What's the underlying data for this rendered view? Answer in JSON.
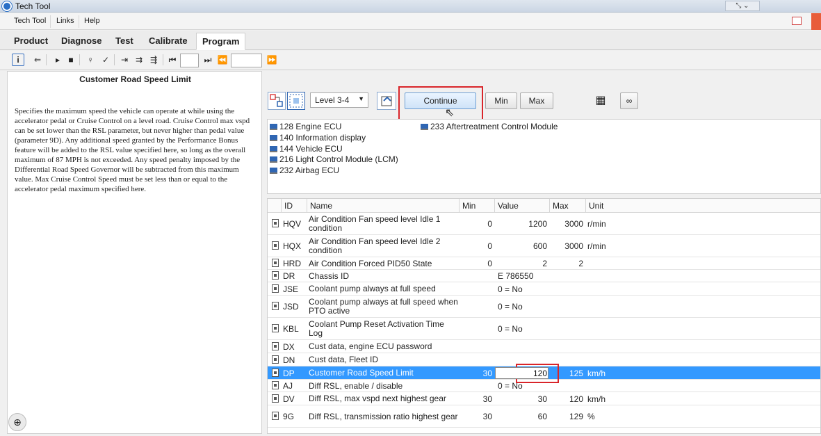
{
  "window": {
    "title": "Tech Tool"
  },
  "menu": {
    "items": [
      "Tech Tool",
      "Links",
      "Help"
    ]
  },
  "tabs": [
    {
      "label": "Product"
    },
    {
      "label": "Diagnose"
    },
    {
      "label": "Test"
    },
    {
      "label": "Calibrate"
    },
    {
      "label": "Program"
    }
  ],
  "left": {
    "title": "Customer Road Speed Limit",
    "description": "Specifies the maximum speed the vehicle can operate at while using the accelerator pedal or Cruise Control on a level road. Cruise Control max vspd can be set lower than the RSL parameter, but never higher than pedal value (parameter 9D). Any additional speed granted by the Performance Bonus feature will be added to the RSL value specified here, so long as the overall maximum of 87 MPH is not exceeded. Any speed penalty imposed by the Differential Road Speed Governor will be subtracted from this maximum value. Max Cruise Control Speed must be set less than or equal to the accelerator pedal maximum specified here."
  },
  "controls": {
    "level": "Level 3-4",
    "continue": "Continue",
    "min": "Min",
    "max": "Max"
  },
  "ecus": [
    {
      "label": "128  Engine ECU"
    },
    {
      "label": "140  Information display"
    },
    {
      "label": "144  Vehicle ECU"
    },
    {
      "label": "216  Light Control Module (LCM)"
    },
    {
      "label": "232  Airbag ECU"
    },
    {
      "label": "233  Aftertreatment Control Module"
    }
  ],
  "grid": {
    "headers": [
      "ID",
      "Name",
      "Min",
      "Value",
      "Max",
      "Unit"
    ],
    "rows": [
      {
        "id": "HQV",
        "name": "Air Condition Fan speed level Idle 1 condition",
        "min": "0",
        "value": "1200",
        "max": "3000",
        "unit": "r/min"
      },
      {
        "id": "HQX",
        "name": "Air Condition Fan speed level Idle 2 condition",
        "min": "0",
        "value": "600",
        "max": "3000",
        "unit": "r/min"
      },
      {
        "id": "HRD",
        "name": "Air Condition Forced PID50 State",
        "min": "0",
        "value": "2",
        "max": "2",
        "unit": ""
      },
      {
        "id": "DR",
        "name": "Chassis ID",
        "min": "",
        "value": "E   786550",
        "max": "",
        "unit": ""
      },
      {
        "id": "JSE",
        "name": "Coolant pump always at full speed",
        "min": "",
        "value": "0 = No",
        "max": "",
        "unit": ""
      },
      {
        "id": "JSD",
        "name": "Coolant pump always at full speed when PTO active",
        "min": "",
        "value": "0 = No",
        "max": "",
        "unit": ""
      },
      {
        "id": "KBL",
        "name": "Coolant Pump Reset Activation Time Log",
        "min": "",
        "value": "0 = No",
        "max": "",
        "unit": ""
      },
      {
        "id": "DX",
        "name": "Cust data, engine ECU password",
        "min": "",
        "value": "",
        "max": "",
        "unit": ""
      },
      {
        "id": "DN",
        "name": "Cust data, Fleet ID",
        "min": "",
        "value": "",
        "max": "",
        "unit": ""
      },
      {
        "id": "DP",
        "name": "Customer Road Speed Limit",
        "min": "30",
        "value": "120",
        "max": "125",
        "unit": "km/h"
      },
      {
        "id": "AJ",
        "name": "Diff RSL, enable / disable",
        "min": "",
        "value": "0 = No",
        "max": "",
        "unit": ""
      },
      {
        "id": "DV",
        "name": "Diff RSL, max vspd next highest gear",
        "min": "30",
        "value": "30",
        "max": "120",
        "unit": "km/h"
      },
      {
        "id": "9G",
        "name": "Diff RSL, transmission ratio highest gear",
        "min": "30",
        "value": "60",
        "max": "129",
        "unit": "%"
      }
    ]
  },
  "colors": {
    "selection": "#3399ff",
    "highlight": "#d9252a"
  },
  "icons": [
    "app-icon",
    "info-icon",
    "back-icon",
    "play-icon",
    "stop-icon",
    "preview-icon",
    "check-icon",
    "zoom-icon",
    "table-icon",
    "link-icon",
    "document-icon",
    "ecu-icon"
  ]
}
